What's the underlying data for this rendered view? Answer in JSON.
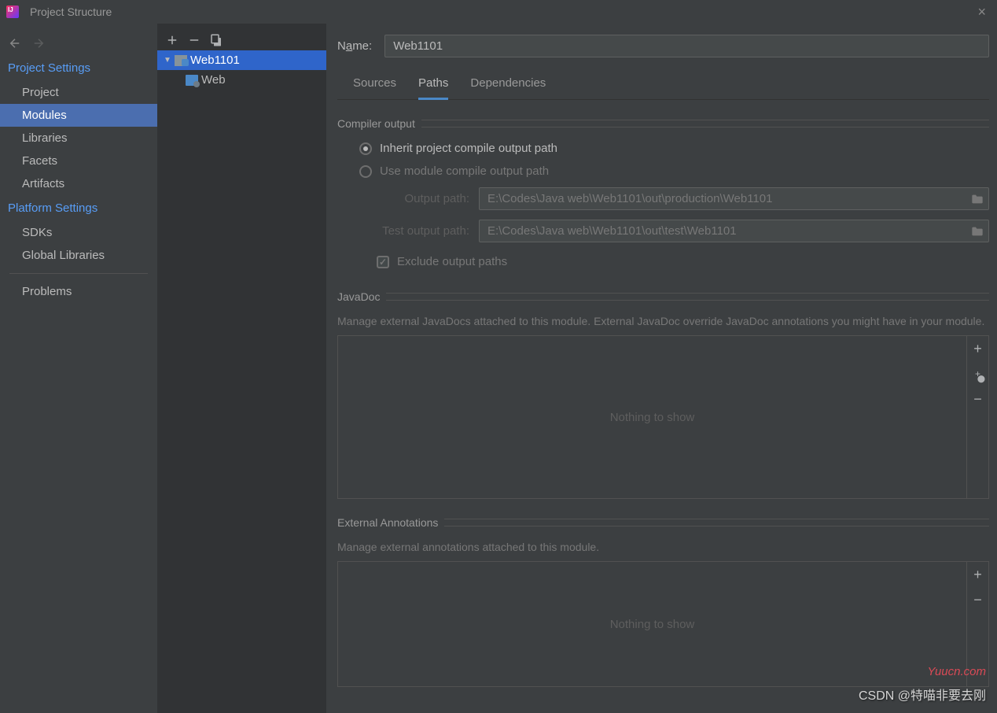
{
  "titlebar": {
    "title": "Project Structure"
  },
  "sidebar": {
    "section1": "Project Settings",
    "items1": [
      "Project",
      "Modules",
      "Libraries",
      "Facets",
      "Artifacts"
    ],
    "section2": "Platform Settings",
    "items2": [
      "SDKs",
      "Global Libraries"
    ],
    "items3": [
      "Problems"
    ]
  },
  "tree": {
    "module": "Web1101",
    "facet": "Web"
  },
  "content": {
    "name_label": "Name:",
    "name_value": "Web1101",
    "tabs": [
      "Sources",
      "Paths",
      "Dependencies"
    ],
    "compiler_section": "Compiler output",
    "radio1": "Inherit project compile output path",
    "radio2": "Use module compile output path",
    "output_label": "Output path:",
    "output_value": "E:\\Codes\\Java web\\Web1101\\out\\production\\Web1101",
    "test_label": "Test output path:",
    "test_value": "E:\\Codes\\Java web\\Web1101\\out\\test\\Web1101",
    "exclude_label": "Exclude output paths",
    "javadoc_section": "JavaDoc",
    "javadoc_desc": "Manage external JavaDocs attached to this module. External JavaDoc override JavaDoc annotations you might have in your module.",
    "nothing": "Nothing to show",
    "annotations_section": "External Annotations",
    "annotations_desc": "Manage external annotations attached to this module."
  },
  "watermarks": {
    "w1": "Yuucn.com",
    "w2": "CSDN @特喵非要去刚"
  }
}
